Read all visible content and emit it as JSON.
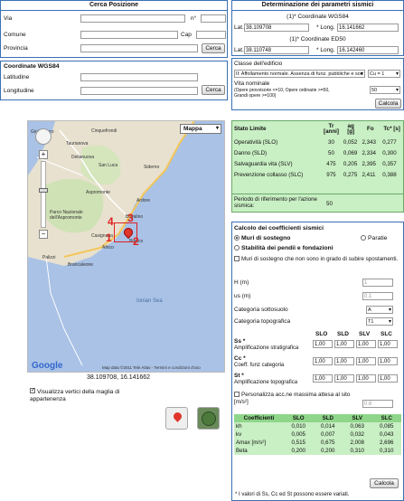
{
  "search": {
    "title": "Cerca Posizione",
    "via_label": "Via",
    "num_label": "n°",
    "comune_label": "Comune",
    "cap_label": "Cap",
    "provincia_label": "Provincia",
    "search_button": "Cerca",
    "coord_title": "Coordinate WGS84",
    "lat_label": "Latitudine",
    "lon_label": "Longitudine",
    "coord_button": "Cerca"
  },
  "params": {
    "title": "Determinazione dei parametri sismici",
    "wgs_title": "(1)* Coordinate WGS84",
    "wgs_lat_label": "Lat.",
    "wgs_lat": "38.109708",
    "wgs_lon_label": "* Long.",
    "wgs_lon": "16.141662",
    "ed_title": "(1)* Coordinate ED50",
    "ed_lat_label": "Lat.",
    "ed_lat": "38.110748",
    "ed_lon_label": "* Long.",
    "ed_lon": "16.142460",
    "classe_title": "Classe dell'edificio",
    "classe_value": "II: Affollamento normale. Assenza di funz. pubbliche e soc",
    "cu_value": "Cu = 1",
    "vita_label": "Vita nominale",
    "vita_note1": "(Opere provvisorie <=10, Opere ordinarie >=50,",
    "vita_note2": "Grandi opere >=100)",
    "vita_value": "50",
    "calcola": "Calcola"
  },
  "map": {
    "type_button": "Mappa",
    "copyright": "Map data ©2011 Tele Atlas - Termini e condizioni d'uso",
    "coord_text": "38.109708, 16.141662",
    "google": "Google",
    "sea_label": "Ionian Sea",
    "places": [
      "Gioia Tauro",
      "Taurianova",
      "San Luca",
      "Siderno",
      "Aspromonte",
      "Parco Nazionale dell'Aspromonte",
      "Ardore",
      "Bovalino",
      "Bianco",
      "Casignana",
      "Africo",
      "Brancaleone",
      "Palizzi",
      "Cinquefrondi",
      "Delianuova"
    ],
    "markers": [
      "4",
      "3",
      "1",
      "2"
    ]
  },
  "map_options": {
    "show_vertices": "Visualizza vertici della maglia di appartenenza"
  },
  "stato": {
    "headers": [
      "Stato Limite",
      "Tr [anni]",
      "ag [g]",
      "Fo",
      "Tc* [s]"
    ],
    "rows": [
      [
        "Operatività (SLO)",
        "30",
        "0,052",
        "2,343",
        "0,277"
      ],
      [
        "Danno (SLD)",
        "50",
        "0,069",
        "2,334",
        "0,300"
      ],
      [
        "Salvaguardia vita (SLV)",
        "475",
        "0,205",
        "2,395",
        "0,357"
      ],
      [
        "Prevenzione collasso (SLC)",
        "975",
        "0,275",
        "2,411",
        "0,388"
      ]
    ],
    "period_label": "Periodo di riferimento per l'azione sismica:",
    "period_value": "50"
  },
  "coeff": {
    "title": "Calcolo dei coefficienti sismici",
    "opt1": "Muri di sostegno",
    "opt2": "Paratie",
    "opt3": "Stabilità dei pendii e fondazioni",
    "chk_muri": "Muri di sostegno che non sono in grado di subire spostamenti.",
    "h_label": "H (m)",
    "h_value": "1",
    "us_label": "us (m)",
    "us_value": "0.1",
    "cat_sott_label": "Categoria sottosuolo",
    "cat_sott_value": "A",
    "cat_topo_label": "Categoria topografica",
    "cat_topo_value": "T1",
    "col_heads": [
      "SLO",
      "SLD",
      "SLV",
      "SLC"
    ],
    "ss_label": "Ss *",
    "ss_sub": "Amplificazione stratigrafica",
    "ss_values": [
      "1,00",
      "1,00",
      "1,00",
      "1,00"
    ],
    "cc_label": "Cc *",
    "cc_sub": "Coeff. funz categoria",
    "cc_values": [
      "1,00",
      "1,00",
      "1,00",
      "1,00"
    ],
    "st_label": "St *",
    "st_sub": "Amplificazione topografica",
    "st_values": [
      "1,00",
      "1,00",
      "1,00",
      "1,00"
    ],
    "pers_label": "Personalizza acc.ne massima attesa al sito [m/s²]",
    "pers_value": "0.6",
    "res_headers": [
      "Coefficienti",
      "SLO",
      "SLD",
      "SLV",
      "SLC"
    ],
    "res_rows": [
      [
        "kh",
        "0,010",
        "0,014",
        "0,063",
        "0,085"
      ],
      [
        "kv",
        "0,005",
        "0,007",
        "0,032",
        "0,043"
      ],
      [
        "Amax [m/s²]",
        "0,515",
        "0,675",
        "2,008",
        "2,696"
      ],
      [
        "Beta",
        "0,200",
        "0,200",
        "0,310",
        "0,310"
      ]
    ],
    "calcola": "Calcola",
    "footnote": "* I valori di Ss, Cc ed St possono essere variati."
  },
  "colors": {
    "accent": "#3a6fb5",
    "green_light": "#c9efc4",
    "green_head": "#8fd68a",
    "blue_light": "#dfe7f3"
  }
}
